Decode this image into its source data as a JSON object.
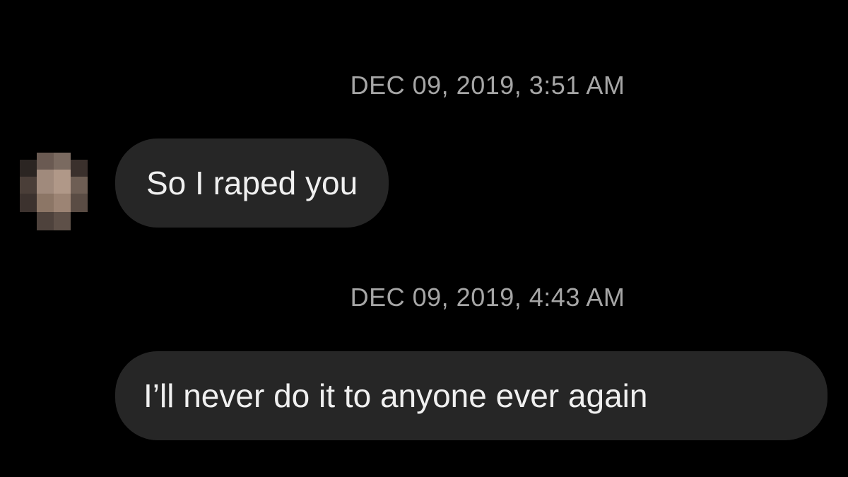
{
  "conversation": {
    "messages": [
      {
        "timestamp": "DEC 09, 2019, 3:51 AM",
        "text": "So I raped you"
      },
      {
        "timestamp": "DEC 09, 2019, 4:43 AM",
        "text": "I’ll never do it to anyone ever again"
      }
    ]
  },
  "colors": {
    "background": "#000000",
    "bubble": "#262626",
    "timestamp_text": "#a6a6a6",
    "message_text": "#f0f0f0"
  },
  "icons": {
    "avatar": "pixelated-avatar-icon"
  }
}
